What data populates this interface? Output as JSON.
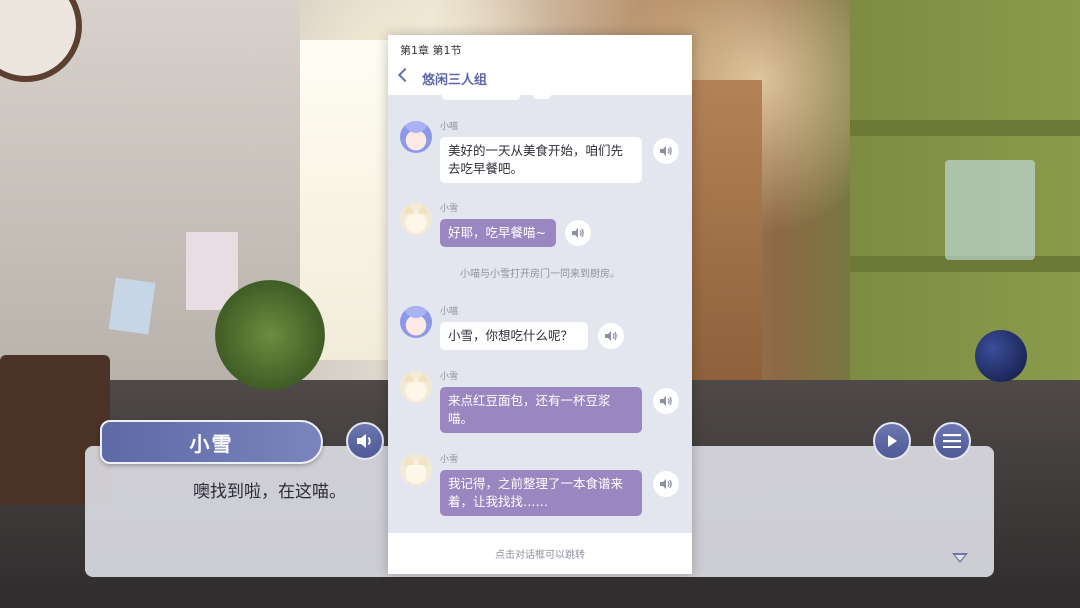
{
  "panel": {
    "chapter": "第1章 第1节",
    "title": "悠闲三人组",
    "narration": "小喵与小雪打开房门一同来到厨房。",
    "footer_hint": "点击对话框可以跳转",
    "messages": [
      {
        "speaker": "小喵",
        "text": "美好的一天从美食开始，咱们先去吃早餐吧。",
        "style": "white"
      },
      {
        "speaker": "小雪",
        "text": "好耶，吃早餐喵~",
        "style": "purple"
      },
      {
        "speaker": "小喵",
        "text": "小雪，你想吃什么呢？",
        "style": "white"
      },
      {
        "speaker": "小雪",
        "text": "来点红豆面包，还有一杯豆浆喵。",
        "style": "purple"
      },
      {
        "speaker": "小雪",
        "text": "我记得，之前整理了一本食谱来着，让我找找……",
        "style": "purple"
      }
    ]
  },
  "dialog": {
    "speaker": "小雪",
    "text": "噢找到啦，在这喵。"
  },
  "icons": {
    "voice": "speaker-icon",
    "play": "play-icon",
    "menu": "menu-icon",
    "next": "triangle-down-icon",
    "back": "chevron-left-icon"
  },
  "colors": {
    "accent": "#5d67a8",
    "purple_bubble": "#9a86c0",
    "panel_bg": "#e4e6ef"
  }
}
